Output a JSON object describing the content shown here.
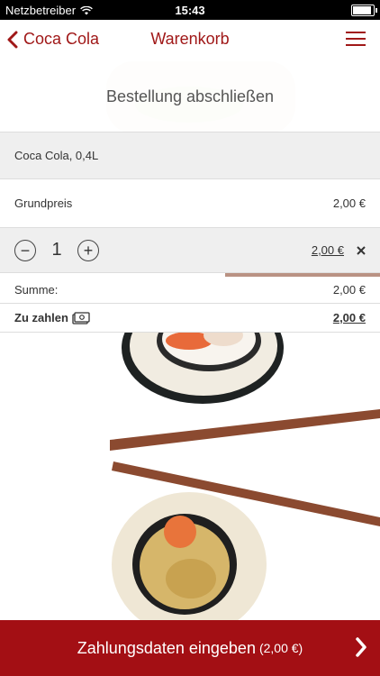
{
  "status": {
    "carrier": "Netzbetreiber",
    "time": "15:43"
  },
  "nav": {
    "back_label": "Coca Cola",
    "title": "Warenkorb"
  },
  "header": {
    "title": "Bestellung abschließen"
  },
  "item": {
    "name": "Coca Cola, 0,4L"
  },
  "base_price": {
    "label": "Grundpreis",
    "value": "2,00 €"
  },
  "quantity": {
    "value": "1",
    "line_total": "2,00 €"
  },
  "sum": {
    "label": "Summe:",
    "value": "2,00 €"
  },
  "to_pay": {
    "label": "Zu zahlen",
    "value": "2,00 €"
  },
  "cta": {
    "label": "Zahlungsdaten eingeben",
    "amount": "(2,00 €)"
  },
  "colors": {
    "accent": "#a30f14",
    "accent_text": "#a01818"
  }
}
